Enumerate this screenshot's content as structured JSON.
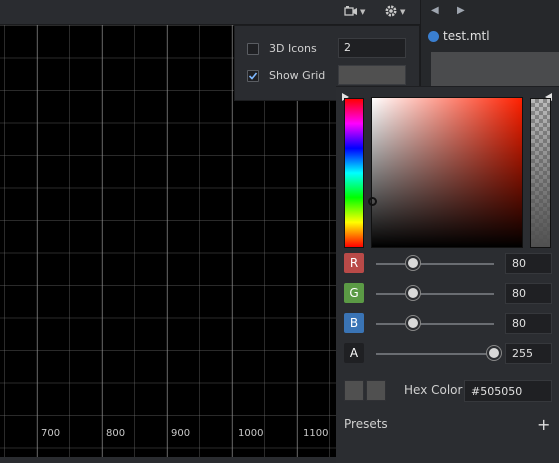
{
  "toolbar": {
    "camera_icon": "camera-icon",
    "gear_icon": "gear-icon"
  },
  "grid_options": {
    "icons_3d": {
      "label": "3D Icons",
      "checked": false,
      "value": "2"
    },
    "show_grid": {
      "label": "Show Grid",
      "checked": true,
      "color": "#505050"
    }
  },
  "viewport": {
    "axis_labels": [
      "700",
      "800",
      "900",
      "1000",
      "1100"
    ]
  },
  "right_panel": {
    "material_name": "test.mtl"
  },
  "color_picker": {
    "channels": [
      {
        "name": "R",
        "value": "80",
        "badge_color": "#b94a48",
        "fraction": 0.314
      },
      {
        "name": "G",
        "value": "80",
        "badge_color": "#5b9a45",
        "fraction": 0.314
      },
      {
        "name": "B",
        "value": "80",
        "badge_color": "#3a74b5",
        "fraction": 0.314
      },
      {
        "name": "A",
        "value": "255",
        "badge_color": "#1f2023",
        "fraction": 1.0
      }
    ],
    "hex_label": "Hex Color",
    "hex_value": "#505050",
    "presets_label": "Presets",
    "add_symbol": "+"
  }
}
